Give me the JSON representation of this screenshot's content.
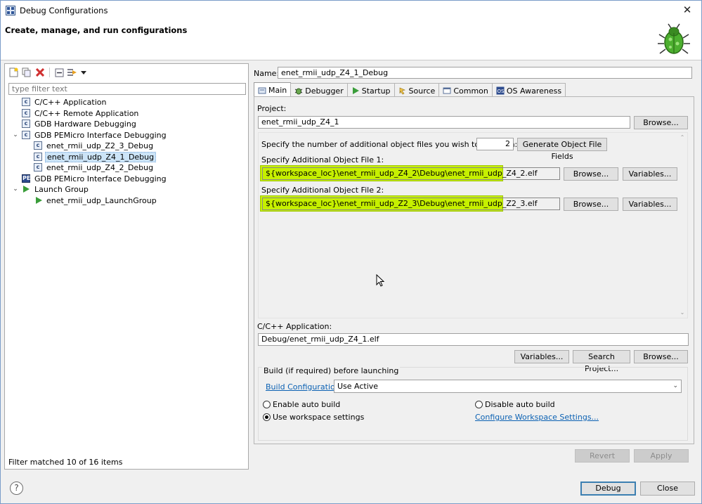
{
  "window": {
    "title": "Debug Configurations",
    "close_glyph": "✕",
    "app_icon": "debug-configurations-icon"
  },
  "header": {
    "title": "Create, manage, and run configurations",
    "banner_icon": "bug-icon"
  },
  "left": {
    "toolbar": [
      "new-config-icon",
      "duplicate-icon",
      "delete-icon",
      "collapse-all-icon",
      "filter-icon",
      "dropdown-arrow-icon"
    ],
    "filter_placeholder": "type filter text",
    "tree": [
      {
        "label": "C/C++ Application",
        "level": 1,
        "icon": "c-config-icon"
      },
      {
        "label": "C/C++ Remote Application",
        "level": 1,
        "icon": "c-config-icon"
      },
      {
        "label": "GDB Hardware Debugging",
        "level": 1,
        "icon": "c-config-icon"
      },
      {
        "label": "GDB PEMicro Interface Debugging",
        "level": 1,
        "icon": "c-config-icon",
        "expanded": true
      },
      {
        "label": "enet_rmii_udp_Z2_3_Debug",
        "level": 2,
        "icon": "c-config-icon"
      },
      {
        "label": "enet_rmii_udp_Z4_1_Debug",
        "level": 2,
        "icon": "c-config-icon",
        "selected": true
      },
      {
        "label": "enet_rmii_udp_Z4_2_Debug",
        "level": 2,
        "icon": "c-config-icon"
      },
      {
        "label": "GDB PEMicro Interface Debugging",
        "level": 1,
        "icon": "pemicro-icon"
      },
      {
        "label": "Launch Group",
        "level": 1,
        "icon": "launch-group-icon",
        "expanded": true
      },
      {
        "label": "enet_rmii_udp_LaunchGroup",
        "level": 2,
        "icon": "launch-group-icon"
      }
    ],
    "status": "Filter matched 10 of 16 items"
  },
  "right": {
    "name_label": "Name:",
    "name_value": "enet_rmii_udp_Z4_1_Debug",
    "tabs": [
      {
        "label": "Main",
        "icon": "main-tab-icon",
        "active": true
      },
      {
        "label": "Debugger",
        "icon": "debugger-tab-icon"
      },
      {
        "label": "Startup",
        "icon": "startup-tab-icon"
      },
      {
        "label": "Source",
        "icon": "source-tab-icon"
      },
      {
        "label": "Common",
        "icon": "common-tab-icon"
      },
      {
        "label": "OS Awareness",
        "icon": "os-tab-icon"
      }
    ],
    "project_label": "Project:",
    "project_value": "enet_rmii_udp_Z4_1",
    "browse": "Browse...",
    "variables": "Variables...",
    "num_files_label": "Specify the number of additional object files you wish to program:",
    "num_files_value": "2",
    "generate_button": "Generate Object File Fields",
    "file1_label": "Specify Additional Object File 1:",
    "file1_value": "${workspace_loc}\\enet_rmii_udp_Z4_2\\Debug\\enet_rmii_udp_Z4_2.elf",
    "file2_label": "Specify Additional Object File 2:",
    "file2_value": "${workspace_loc}\\enet_rmii_udp_Z2_3\\Debug\\enet_rmii_udp_Z2_3.elf",
    "app_label": "C/C++ Application:",
    "app_value": "Debug/enet_rmii_udp_Z4_1.elf",
    "search_project": "Search Project...",
    "build_group_title": "Build (if required) before launching",
    "build_config_link": "Build Configuration:",
    "build_config_value": "Use Active",
    "enable_auto": "Enable auto build",
    "disable_auto": "Disable auto build",
    "use_workspace": "Use workspace settings",
    "configure_link": "Configure Workspace Settings...",
    "revert": "Revert",
    "apply": "Apply"
  },
  "footer": {
    "help_glyph": "?",
    "debug": "Debug",
    "close": "Close"
  },
  "colors": {
    "highlight": "#c6f000",
    "link": "#0b61b3",
    "selection": "#cce4f7"
  }
}
